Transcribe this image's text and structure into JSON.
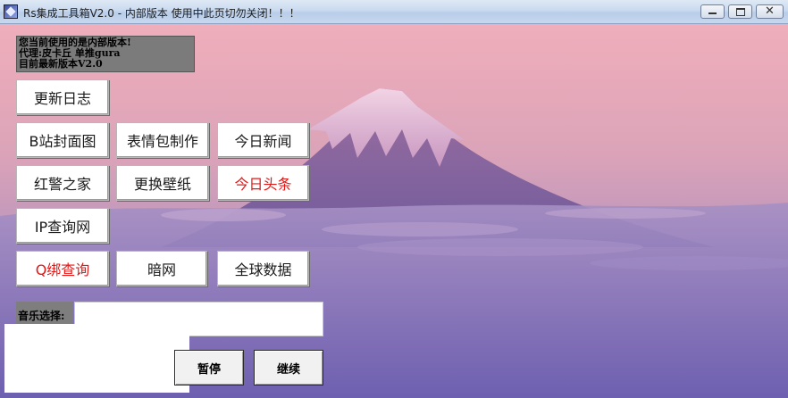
{
  "window": {
    "title": "Rs集成工具箱V2.0 - 内部版本 使用中此页切勿关闭！！！",
    "controls": {
      "close_glyph": "✕"
    }
  },
  "info": {
    "lines": [
      "您当前使用的是内部版本!",
      "代理:皮卡丘 单推gura",
      "目前最新版本V2.0"
    ]
  },
  "buttons": {
    "changelog": "更新日志",
    "bili_cover": "B站封面图",
    "meme_maker": "表情包制作",
    "today_news": "今日新闻",
    "redalert_home": "红警之家",
    "change_wallpaper": "更换壁纸",
    "today_headlines": "今日头条",
    "ip_lookup": "IP查询网",
    "qq_bind_lookup": "Q绑查询",
    "dark_web": "暗网",
    "global_data": "全球数据"
  },
  "music": {
    "label": "音乐选择:",
    "value": "",
    "pause": "暂停",
    "resume": "继续"
  },
  "colors": {
    "red_text": "#e01818"
  }
}
